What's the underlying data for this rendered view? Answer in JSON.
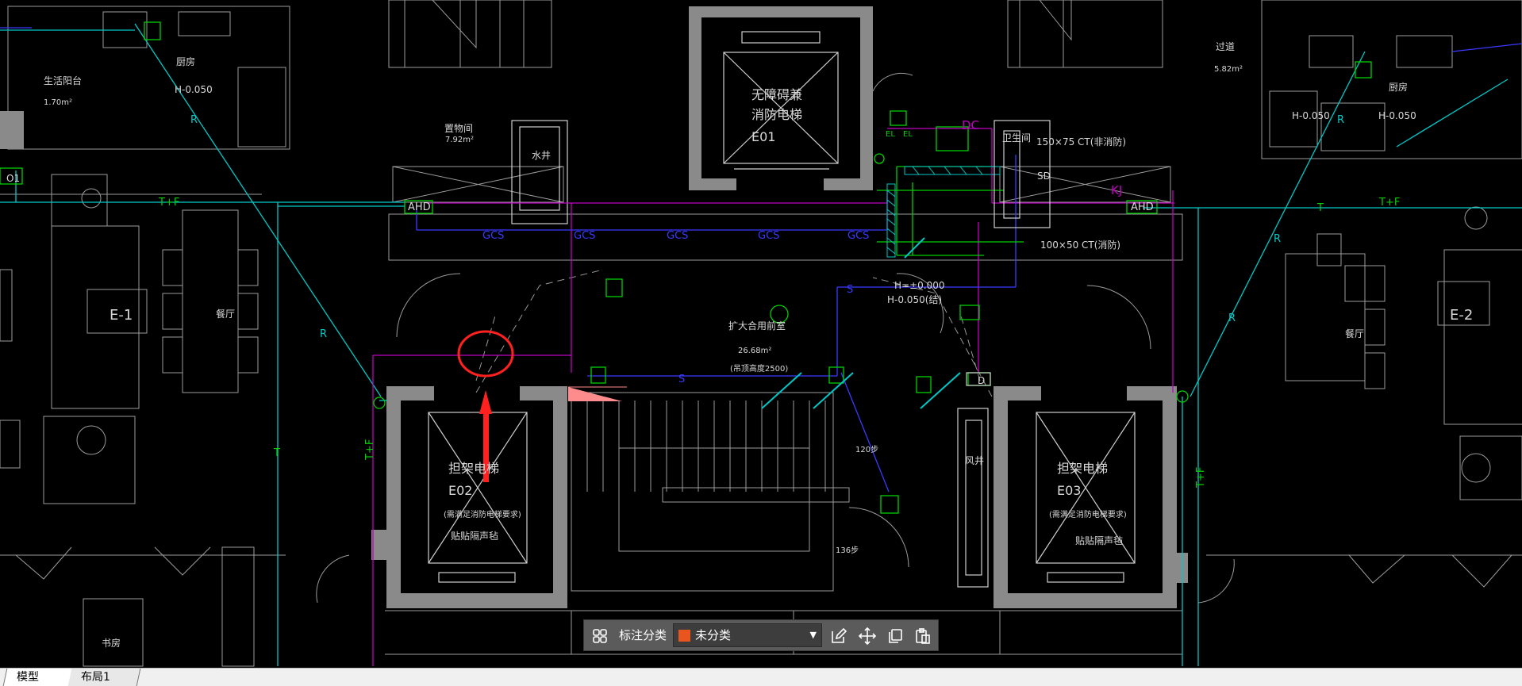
{
  "colors": {
    "background": "#000000",
    "wall_gray": "#8a8a8a",
    "cyan": "#00c8c8",
    "magenta": "#c000c0",
    "blue": "#3a3aff",
    "green": "#00d000",
    "red_annotation": "#ff2020",
    "swatch": "#e8551e"
  },
  "drawing": {
    "labels": {
      "elevator_main": "无障碍兼",
      "elevator_main_2": "消防电梯",
      "elevator_main_code": "E01",
      "water_well": "水井",
      "storage_room": "置物间",
      "storage_room_area": "7.92m²",
      "balcony": "生活阳台",
      "balcony_area": "1.70m²",
      "kitchen_left": "厨房",
      "kitchen_left_level": "H-0.050",
      "kitchen_right": "厨房",
      "h_level_1": "H-0.050",
      "h_level_2": "H-0.050",
      "corridor": "过道",
      "corridor_area": "5.82m²",
      "unit_left": "E-1",
      "unit_right": "E-2",
      "dining_left": "餐厅",
      "dining_right": "餐厅",
      "lobby": "扩大合用前室",
      "lobby_area": "26.68m²",
      "lobby_note": "(吊顶高度2500)",
      "level_main": "H=±0.000",
      "level_sub": "H-0.050(结)",
      "stretcher_left": "担架电梯",
      "stretcher_left_code": "E02",
      "stretcher_left_note": "(需满足消防电梯要求)",
      "stretcher_left_tag": "贴贴隔声毡",
      "stretcher_right": "担架电梯",
      "stretcher_right_code": "E03",
      "stretcher_right_note": "(需满足消防电梯要求)",
      "stretcher_right_tag": "贴贴隔声毡",
      "air_shaft": "风井",
      "study": "书房",
      "ahd_left": "AHD",
      "ahd_right": "AHD",
      "tf_left": "T+F",
      "tf_right": "T+F",
      "tf_vertical_left": "T+F",
      "tf_vertical_right": "T+F",
      "t_right": "T",
      "t_vertical": "T",
      "r_labels": "R",
      "kj": "KJ",
      "gcs": "GCS",
      "dc": "DC",
      "sd": "SD",
      "s_label": "S",
      "ct1": "150×75  CT(非消防)",
      "ct2": "100×50  CT(消防)",
      "el": "EL",
      "dim_120": "120步",
      "dim_136": "136步",
      "d_tag": "D",
      "o1": "O1",
      "toilet": "卫生间"
    }
  },
  "toolbar": {
    "label": "标注分类",
    "category_value": "未分类",
    "icons": [
      "grid-icon",
      "edit-icon",
      "move-icon",
      "copy-icon",
      "paste-icon"
    ]
  },
  "tabs": {
    "model": "模型",
    "layout": "布局1"
  }
}
